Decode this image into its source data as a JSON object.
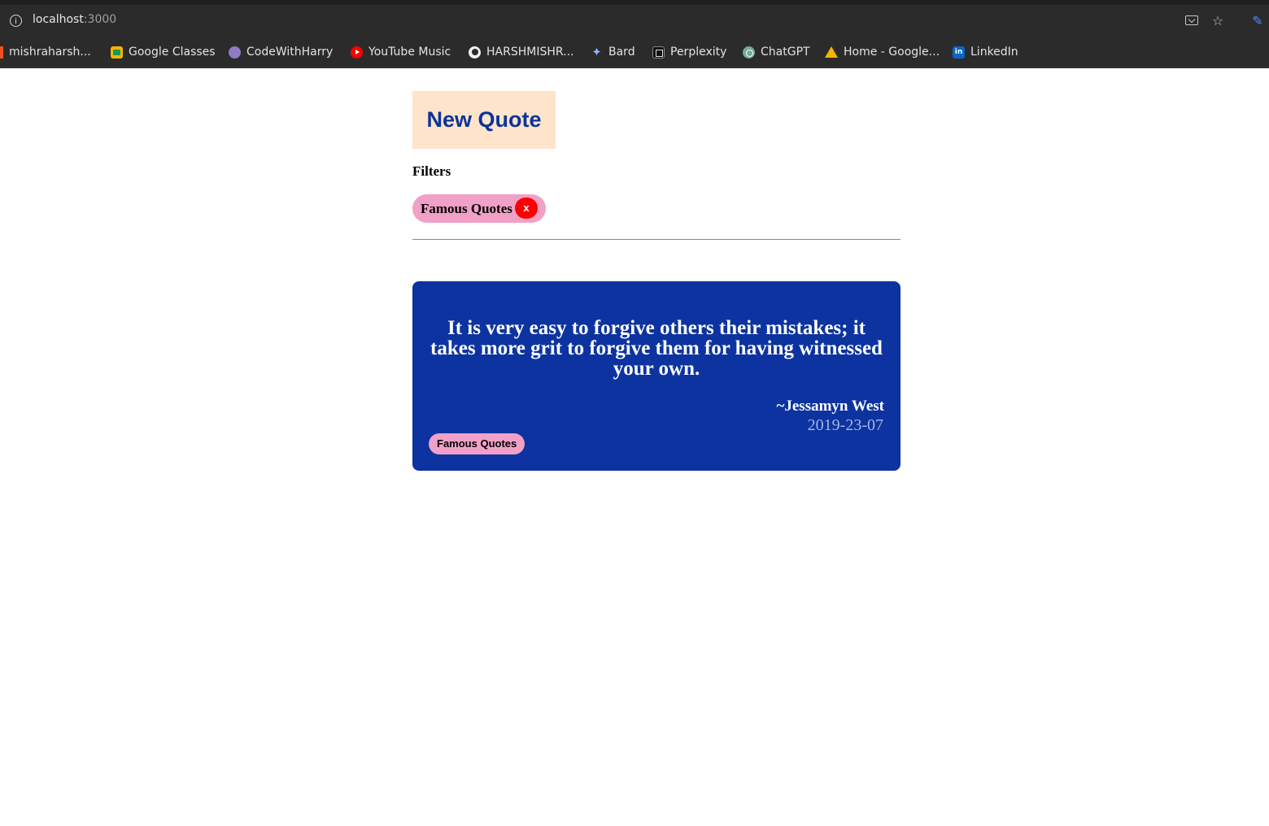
{
  "browser": {
    "url_host": "localhost",
    "url_port": ":3000",
    "bookmarks": [
      {
        "label": "mishraharsh...",
        "icon": "ms-icon"
      },
      {
        "label": "Google Classes",
        "icon": "google-classroom-icon"
      },
      {
        "label": "CodeWithHarry",
        "icon": "codewithharry-icon"
      },
      {
        "label": "YouTube Music",
        "icon": "youtube-music-icon"
      },
      {
        "label": "HARSHMISHR...",
        "icon": "github-icon"
      },
      {
        "label": "Bard",
        "icon": "bard-icon"
      },
      {
        "label": "Perplexity",
        "icon": "perplexity-icon"
      },
      {
        "label": "ChatGPT",
        "icon": "chatgpt-icon"
      },
      {
        "label": "Home - Google...",
        "icon": "google-drive-icon"
      },
      {
        "label": "LinkedIn",
        "icon": "linkedin-icon"
      }
    ]
  },
  "app": {
    "new_quote_label": "New Quote",
    "filters_label": "Filters",
    "active_filter": "Famous Quotes",
    "remove_filter_label": "x",
    "quote": {
      "text": "It is very easy to forgive others their mistakes; it takes more grit to forgive them for having witnessed your own.",
      "author": "~Jessamyn West",
      "date": "2019-23-07",
      "tag": "Famous Quotes"
    }
  },
  "colors": {
    "card_bg": "#0c33a0",
    "button_bg": "#ffe4cc",
    "button_text": "#0c3399",
    "chip_bg": "#f1a0c7",
    "remove_bg": "#ff0000"
  }
}
